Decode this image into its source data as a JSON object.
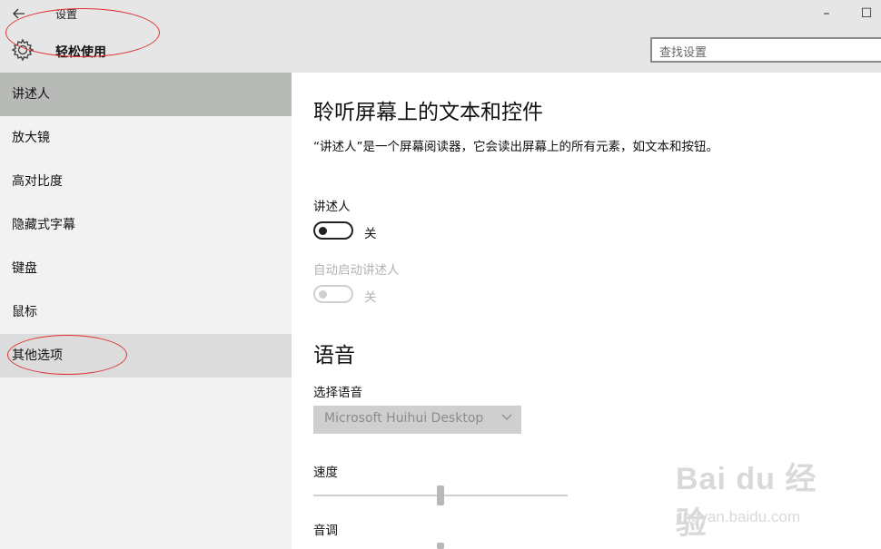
{
  "window": {
    "title": "设置",
    "minimize_glyph": "–",
    "maximize_glyph": "☐"
  },
  "header": {
    "section_title": "轻松使用",
    "search_placeholder": "查找设置"
  },
  "sidebar": {
    "items": [
      {
        "label": "讲述人",
        "state": "selected"
      },
      {
        "label": "放大镜",
        "state": "normal"
      },
      {
        "label": "高对比度",
        "state": "normal"
      },
      {
        "label": "隐藏式字幕",
        "state": "normal"
      },
      {
        "label": "键盘",
        "state": "normal"
      },
      {
        "label": "鼠标",
        "state": "normal"
      },
      {
        "label": "其他选项",
        "state": "hover"
      }
    ]
  },
  "main": {
    "heading": "聆听屏幕上的文本和控件",
    "description": "“讲述人”是一个屏幕阅读器，它会读出屏幕上的所有元素，如文本和按钮。",
    "narrator": {
      "label": "讲述人",
      "state_text": "关",
      "on": false
    },
    "auto_start": {
      "label": "自动启动讲述人",
      "state_text": "关",
      "on": false,
      "disabled": true
    },
    "voice_heading": "语音",
    "choose_voice_label": "选择语音",
    "voice_selected": "Microsoft Huihui Desktop",
    "speed_label": "速度",
    "pitch_label": "音调"
  },
  "watermark": {
    "brand": "Bai du 经验",
    "url": "jingyan.baidu.com"
  },
  "colors": {
    "topbar_bg": "#e6e6e6",
    "sidebar_bg": "#f2f2f2",
    "selected_bg": "#b8bab7",
    "annotation": "#e03030"
  }
}
